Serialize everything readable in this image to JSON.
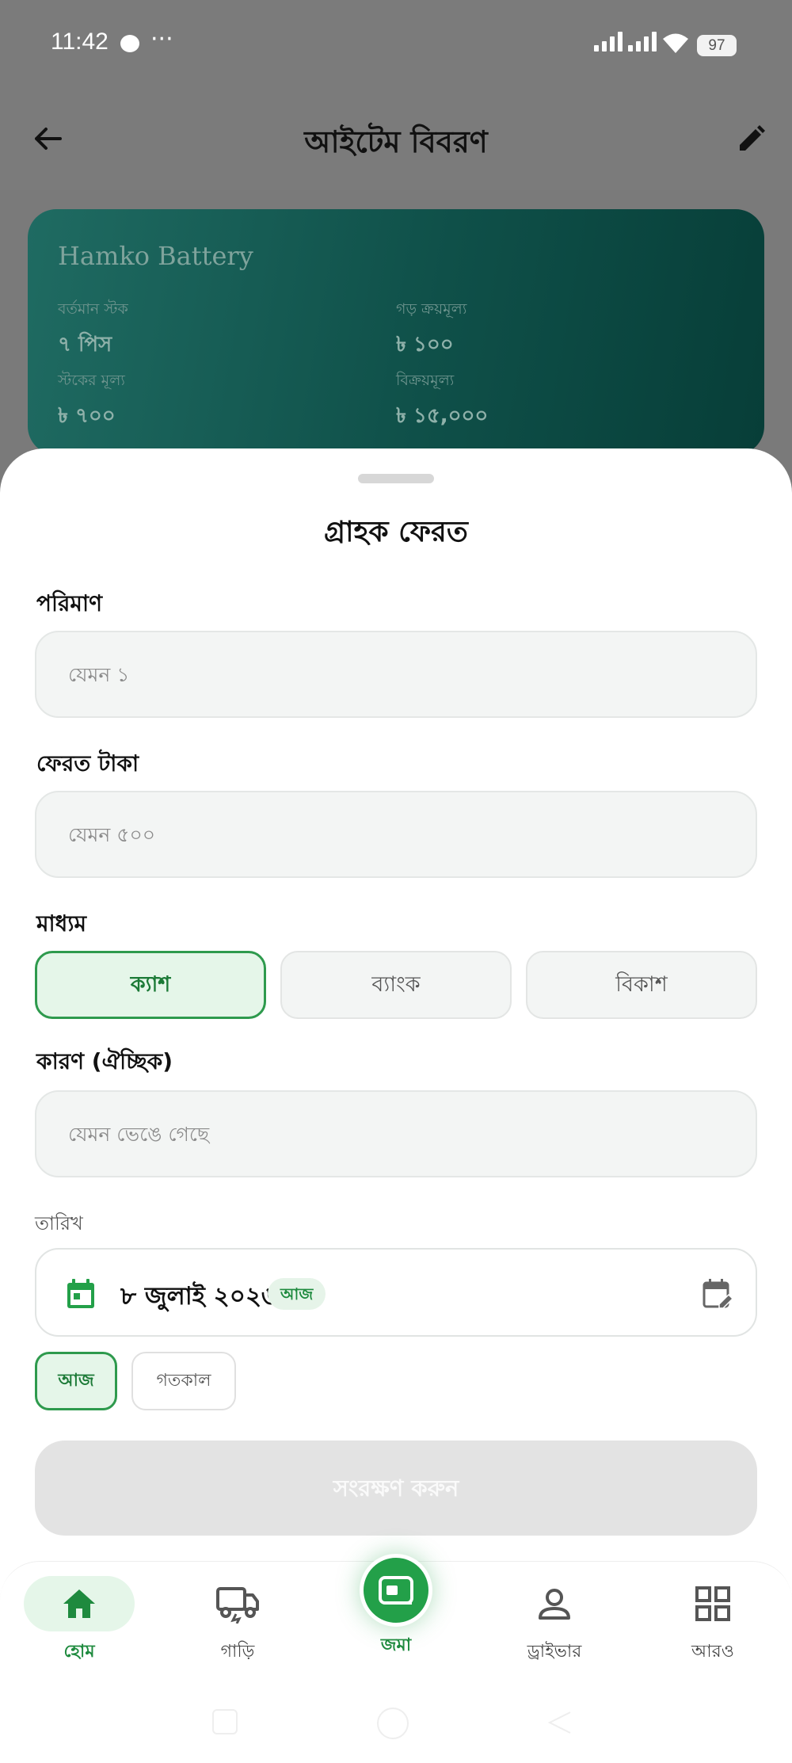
{
  "status_bar": {
    "time": "11:42",
    "dots": "···",
    "battery": "97"
  },
  "app_bar": {
    "title": "আইটেম বিবরণ"
  },
  "item_card": {
    "name": "Hamko Battery",
    "current_stock_label": "বর্তমান স্টক",
    "current_stock_value": "৭ পিস",
    "avg_cost_label": "গড় ক্রয়মূল্য",
    "avg_cost_value": "৳ ১০০",
    "stock_value_label": "স্টকের মূল্য",
    "stock_value_value": "৳ ৭০০",
    "sale_price_label": "বিক্রয়মূল্য",
    "sale_price_value": "৳ ১৫,০০০"
  },
  "sheet": {
    "title": "গ্রাহক ফেরত",
    "quantity_label": "পরিমাণ",
    "quantity_placeholder": "যেমন ১",
    "refund_label": "ফেরত টাকা",
    "refund_placeholder": "যেমন ৫০০",
    "method_label": "মাধ্যম",
    "methods": [
      "ক্যাশ",
      "ব্যাংক",
      "বিকাশ"
    ],
    "selected_method": "ক্যাশ",
    "reason_label": "কারণ (ঐচ্ছিক)",
    "reason_placeholder": "যেমন ভেঙে গেছে",
    "date_label": "তারিখ",
    "date_value": "৮ জুলাই ২০২৬",
    "date_badge": "আজ",
    "quick_dates": [
      "আজ",
      "গতকাল"
    ],
    "selected_quick_date": "আজ",
    "save_label": "সংরক্ষণ করুন"
  },
  "bottom_nav": {
    "items": [
      "হোম",
      "গাড়ি",
      "জমা",
      "ড্রাইভার",
      "আরও"
    ],
    "active": "হোম"
  },
  "colors": {
    "accent": "#23a049",
    "card_dark": "#0f5049",
    "selected_bg": "#e5f6e9"
  },
  "icons": [
    "back-arrow-icon",
    "pencil-icon",
    "calendar-icon",
    "calendar-edit-icon",
    "home-icon",
    "truck-icon",
    "wallet-icon",
    "person-icon",
    "grid-icon"
  ]
}
